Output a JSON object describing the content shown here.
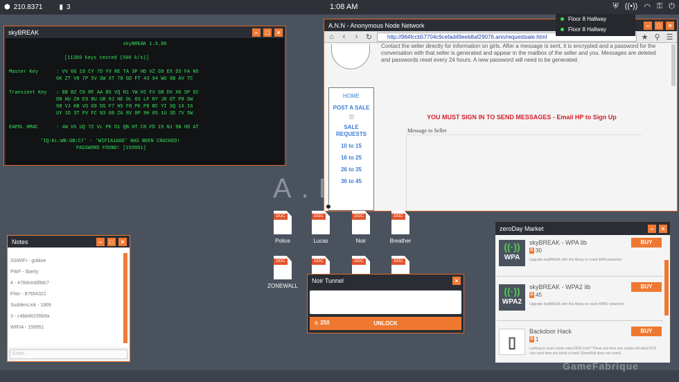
{
  "topbar": {
    "money": "210.8371",
    "notes_count": "3",
    "clock": "1:08 AM",
    "right_icons": [
      "shield-icon",
      "broadcast-icon",
      "wifi-icon",
      "lock-icon",
      "power-icon"
    ]
  },
  "desktop_bg_text": "A.D",
  "skybreak": {
    "title": "skyBREAK",
    "header": "skyBREAK 1.5.89",
    "keys_tested": "[11309 keys tested (500 k/s)]",
    "master_key_label": "Master Key",
    "master_key_lines": [
      ": VV 6G 19 CY 7D YV RE TA 3P HD VZ G9 EX D3 FA N6",
      "6K ZT V8 7P 5V SW XT 78 GD FT 43 94 WU 6B AV TC"
    ],
    "transient_key_label": "Transient Key",
    "transient_key_lines": [
      ": 8B BZ C8 RF AA B5 VQ N1 YW HI FV GB DV XK SP SC",
      "DN HU ZH E9 BU UR 9J HE 0L 65 LF RY J8 GT P8 GW",
      "98 VJ KB VS G9 DG F7 H5 F8 PK P8 BC YI SQ 1X I6",
      "UY 1D 3T PV FC N3 08 ZA 8V 8P 9H 05 1U 3D 7V 5W"
    ],
    "eapol_label": "EAPOL HMAC",
    "eapol_line": ": 4W VX UQ 7Z VL PK D1 QB HT C8 FD 15 N1 9N HD AT",
    "cracked_line": "'IQ:KL:WB:GB:C7' - 'WIFIA1ASD' HAS BEEN CRACKED!",
    "password_line": "PASSWORD FOUND! [159951]"
  },
  "ann": {
    "title": "A.N.N - Anonymous Node Network",
    "url": "http://984fccb57704c9cefad49eeb8af29076.ann/requestsale.html",
    "intro": "Contact the seller directly for information on girls. After a message is sent, it is encrypted and a password for the conversation with that seller is generated and appear in the mailbox of the seller and you. Messages are deleted and passwords reset every 24 hours. A new password will need to be generated.",
    "menu": [
      "HOME",
      "POST A SALE",
      "SALE REQUESTS",
      "10 to 15",
      "16 to 25",
      "26 to 35",
      "36 to 45"
    ],
    "signin_msg": "YOU MUST SIGN IN TO SEND MESSAGES - Email HP to Sign Up",
    "message_label": "Message to Seller"
  },
  "notes": {
    "title": "Notes",
    "lines": [
      "SSWIFI - goblue",
      "PWF - liberty",
      "4 - 478dcedd9dc7",
      "Fher - 87654321",
      "SuddenLink - 1969",
      "3 - c4bb48235b9a",
      "WIFIA - 159951"
    ],
    "input_placeholder": "Enter..."
  },
  "desktop_icons": [
    "Police",
    "Lucas",
    "Noir",
    "Breather",
    "ZONEWALL",
    "",
    "",
    ""
  ],
  "doc_tag": "DOC",
  "noir": {
    "title": "Noir Tunnel",
    "cost": "250",
    "button": "UNLOCK"
  },
  "market": {
    "title": "zeroDay Market",
    "items": [
      {
        "name": "skyBREAK - WPA lib",
        "price": "30",
        "icon": "WPA",
        "desc": "Upgrade skyBREAK with this library to crack WPA networks!",
        "buy": "BUY"
      },
      {
        "name": "skyBREAK - WPA2 lib",
        "price": "45",
        "icon": "WPA2",
        "desc": "Upgrade skyBREAK with this library to crack WPA2 networks!",
        "buy": "BUY"
      },
      {
        "name": "Backdoor Hack",
        "price": "1",
        "icon": "door-icon",
        "desc": "Looking to score some extra DOS Coin? These one time use scripts will steal DOS coin each time you block a hack! (ZoneWall does not count)",
        "buy": "BUY"
      }
    ]
  },
  "network_dropdown": [
    "Floor 8 Hallway",
    "Floor 8 Hallway"
  ],
  "watermark": "GameFabrique"
}
